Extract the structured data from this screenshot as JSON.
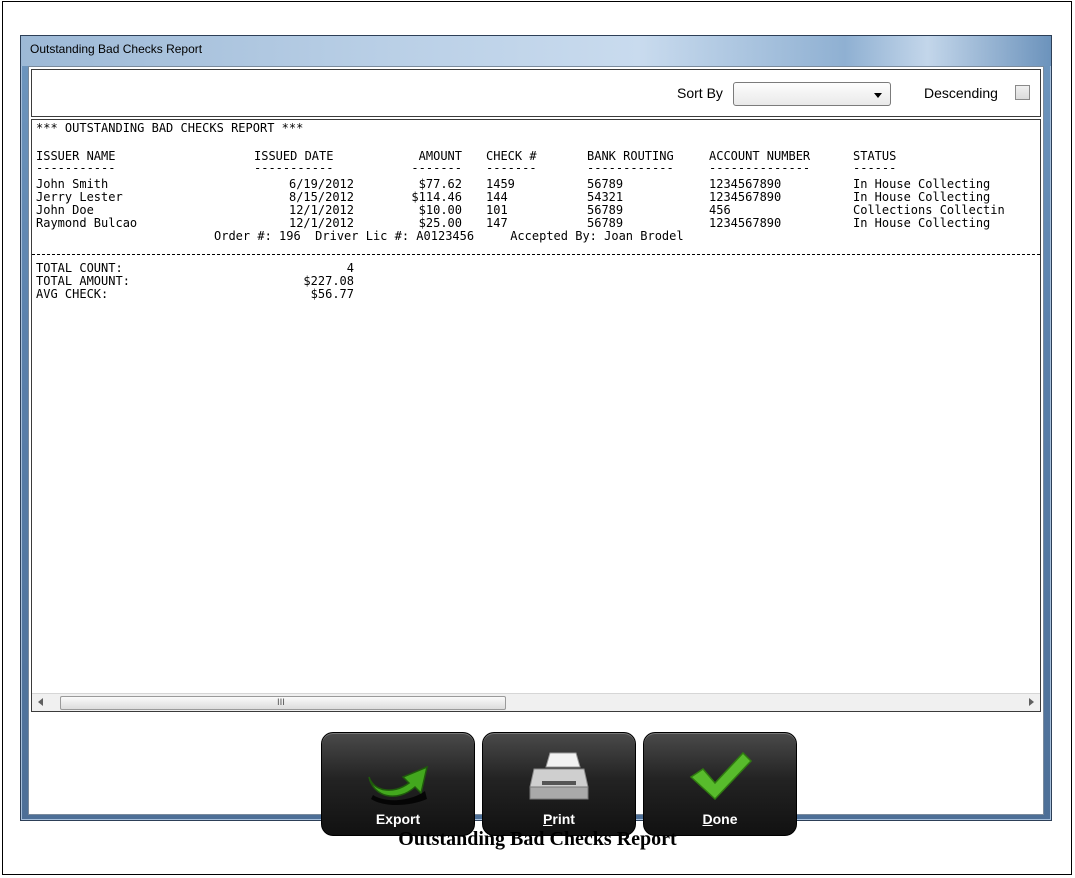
{
  "window": {
    "title": "Outstanding Bad Checks Report"
  },
  "toolbar": {
    "sort_by_label": "Sort By",
    "sort_by_value": "",
    "descending_label": "Descending",
    "descending_checked": false
  },
  "report": {
    "header_line": "*** OUTSTANDING BAD CHECKS REPORT ***",
    "columns": {
      "issuer_name": "ISSUER NAME",
      "issued_date": "ISSUED DATE",
      "amount": "AMOUNT",
      "check_no": "CHECK #",
      "bank_routing": "BANK ROUTING",
      "account_number": "ACCOUNT NUMBER",
      "status": "STATUS"
    },
    "underlines": {
      "issuer_name": "-----------",
      "issued_date": "-----------",
      "amount": "-------",
      "check_no": "-------",
      "bank_routing": "------------",
      "account_number": "--------------",
      "status": "------"
    },
    "rows": [
      {
        "issuer_name": "John Smith",
        "issued_date": "6/19/2012",
        "amount": "$77.62",
        "check_no": "1459",
        "bank_routing": "56789",
        "account_number": "1234567890",
        "status": "In House Collecting"
      },
      {
        "issuer_name": "Jerry Lester",
        "issued_date": "8/15/2012",
        "amount": "$114.46",
        "check_no": "144",
        "bank_routing": "54321",
        "account_number": "1234567890",
        "status": "In House Collecting"
      },
      {
        "issuer_name": "John Doe",
        "issued_date": "12/1/2012",
        "amount": "$10.00",
        "check_no": "101",
        "bank_routing": "56789",
        "account_number": "456",
        "status": "Collections Collectin"
      },
      {
        "issuer_name": "Raymond Bulcao",
        "issued_date": "12/1/2012",
        "amount": "$25.00",
        "check_no": "147",
        "bank_routing": "56789",
        "account_number": "1234567890",
        "status": "In House Collecting"
      }
    ],
    "detail_line": "Order #: 196  Driver Lic #: A0123456     Accepted By: Joan Brodel",
    "totals": [
      {
        "label": "TOTAL COUNT:",
        "value": "4"
      },
      {
        "label": "TOTAL AMOUNT:",
        "value": "$227.08"
      },
      {
        "label": "AVG CHECK:",
        "value": "$56.77"
      }
    ],
    "scroll_grip": "III"
  },
  "buttons": {
    "export": {
      "label": "Export",
      "icon": "export-arrow-icon"
    },
    "print": {
      "label": "Print",
      "icon": "printer-icon"
    },
    "done": {
      "label": "Done",
      "icon": "checkmark-icon"
    }
  },
  "caption": "Outstanding Bad Checks Report",
  "colors": {
    "window_chrome": "#5a80ab",
    "button_bg": "#1c1c1c",
    "export_green": "#3c9a1c",
    "done_green": "#55b82a"
  }
}
